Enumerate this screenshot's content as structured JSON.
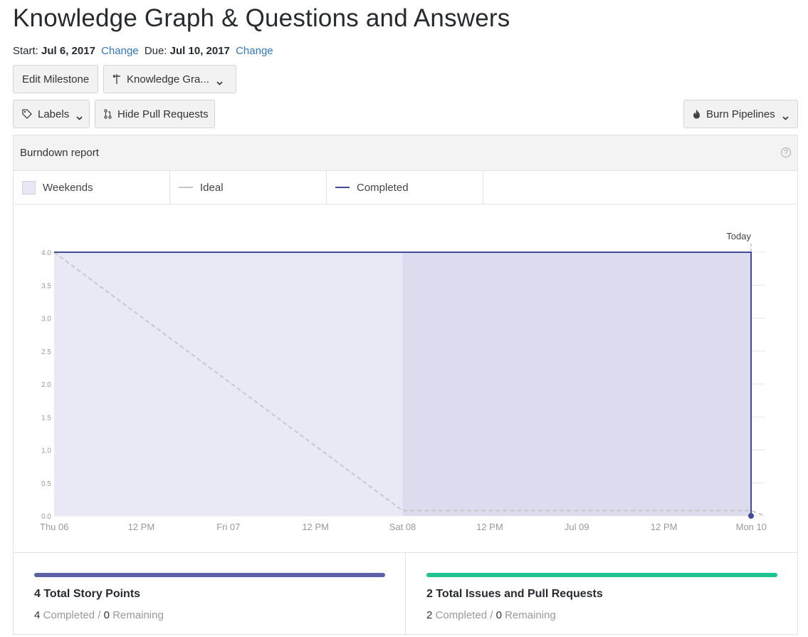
{
  "milestone": {
    "title": "Knowledge Graph & Questions and Answers",
    "start_label": "Start:",
    "start_date": "Jul 6, 2017",
    "due_label": "Due:",
    "due_date": "Jul 10, 2017",
    "change_label": "Change"
  },
  "toolbar": {
    "edit_label": "Edit Milestone",
    "milestone_select": "Knowledge Gra...",
    "labels_label": "Labels",
    "hide_prs_label": "Hide Pull Requests",
    "burn_label": "Burn Pipelines"
  },
  "report": {
    "title": "Burndown report",
    "help": "?",
    "legend": {
      "weekends": "Weekends",
      "ideal": "Ideal",
      "completed": "Completed"
    }
  },
  "chart_data": {
    "type": "line",
    "x_ticks": [
      "Thu 06",
      "12 PM",
      "Fri 07",
      "12 PM",
      "Sat 08",
      "12 PM",
      "Jul 09",
      "12 PM",
      "Mon 10"
    ],
    "y_ticks": [
      "0.0",
      "0.5",
      "1.0",
      "1.5",
      "2.0",
      "2.5",
      "3.0",
      "3.5",
      "4.0"
    ],
    "ylim": [
      0,
      4
    ],
    "today_label": "Today",
    "weekend_range": [
      "Sat 08",
      "Mon 10"
    ],
    "series": [
      {
        "name": "Ideal",
        "points": [
          [
            "Thu 06",
            4.0
          ],
          [
            "Sat 08",
            0.08
          ],
          [
            "Mon 10",
            0.08
          ]
        ]
      },
      {
        "name": "Completed",
        "points": [
          [
            "Thu 06",
            4.0
          ],
          [
            "Mon 10",
            4.0
          ],
          [
            "Mon 10",
            0.0
          ]
        ]
      }
    ],
    "colors": {
      "ideal": "#c8c8c8",
      "completed": "#3f4b96",
      "area": "#e9e9f6",
      "weekend": "#dcdcef"
    }
  },
  "stats": {
    "points": {
      "title": "4 Total Story Points",
      "completed": "4",
      "completed_label": "Completed",
      "remaining": "0",
      "remaining_label": "Remaining",
      "color": "#5e60a8"
    },
    "issues": {
      "title": "2 Total Issues and Pull Requests",
      "completed": "2",
      "completed_label": "Completed",
      "remaining": "0",
      "remaining_label": "Remaining",
      "color": "#1fc38f"
    }
  }
}
